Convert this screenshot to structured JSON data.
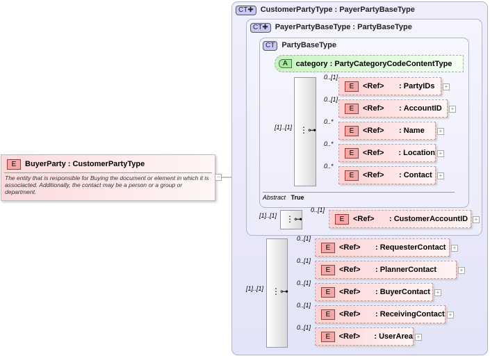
{
  "element": {
    "badge": "E",
    "name": "BuyerParty",
    "type": "CustomerPartyType",
    "doc": "The entity that is responsible for Buying the document or element in which it is associacted. Additionally, the contact  may be a person or a group or department.",
    "toggle": "−"
  },
  "types": [
    {
      "badge": "CT✚",
      "name": "CustomerPartyType",
      "base": "PayerPartyBaseType"
    },
    {
      "badge": "CT✚",
      "name": "PayerPartyBaseType",
      "base": "PartyBaseType"
    },
    {
      "badge": "CT",
      "name": "PartyBaseType"
    }
  ],
  "attribute": {
    "badge": "A",
    "name": "category",
    "type": "PartyCategoryCodeContentType"
  },
  "abstract": {
    "label": "Abstract",
    "value": "True"
  },
  "seq_cardinality": "[1]..[1]",
  "party_base_elements": [
    {
      "card": "0..[1]",
      "ref": "<Ref>",
      "name": "PartyIDs"
    },
    {
      "card": "0..[1]",
      "ref": "<Ref>",
      "name": "AccountID"
    },
    {
      "card": "0..*",
      "ref": "<Ref>",
      "name": "Name"
    },
    {
      "card": "0..*",
      "ref": "<Ref>",
      "name": "Location"
    },
    {
      "card": "0..*",
      "ref": "<Ref>",
      "name": "Contact"
    }
  ],
  "payer_elements": [
    {
      "card": "0..[1]",
      "ref": "<Ref>",
      "name": "CustomerAccountID"
    }
  ],
  "customer_elements": [
    {
      "card": "0..[1]",
      "ref": "<Ref>",
      "name": "RequesterContact"
    },
    {
      "card": "0..[1]",
      "ref": "<Ref>",
      "name": "PlannerContact"
    },
    {
      "card": "0..[1]",
      "ref": "<Ref>",
      "name": "BuyerContact"
    },
    {
      "card": "0..[1]",
      "ref": "<Ref>",
      "name": "ReceivingContact"
    },
    {
      "card": "0..[1]",
      "ref": "<Ref>",
      "name": "UserArea"
    }
  ],
  "expand_symbol": "+",
  "colors": {
    "element_bg": "#fcd2d2",
    "attribute_bg": "#d8f8d0",
    "type_bg": "#e8e8fa"
  }
}
